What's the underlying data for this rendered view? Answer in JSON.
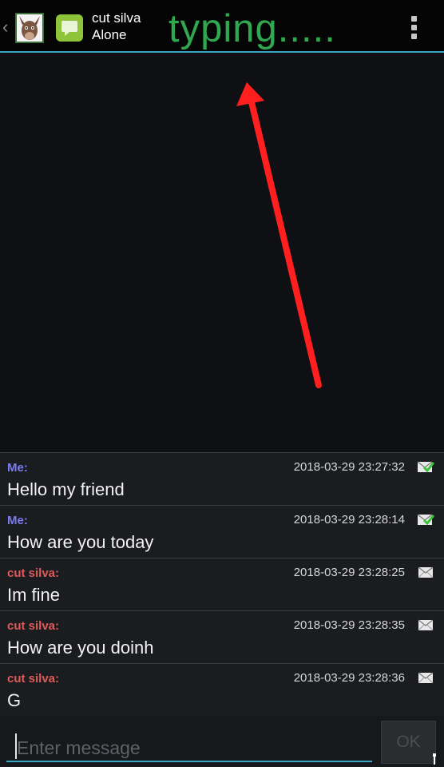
{
  "header": {
    "back_glyph": "‹",
    "title": "cut silva",
    "subtitle": "Alone",
    "annotation": "typing.....",
    "accent_color": "#3aa6c6",
    "annotation_color": "#2fa84f"
  },
  "annotation_arrow": {
    "color": "#ff1f1f",
    "label": ""
  },
  "messages": [
    {
      "sender": "Me:",
      "time": "2018-03-29 23:27:32",
      "text": "Hello my friend",
      "status_icon": "delivered-check-envelope-icon"
    },
    {
      "sender": "Me:",
      "time": "2018-03-29 23:28:14",
      "text": "How are you today",
      "status_icon": "delivered-check-envelope-icon"
    },
    {
      "sender": "cut silva:",
      "time": "2018-03-29 23:28:25",
      "text": "Im fine",
      "status_icon": "envelope-icon"
    },
    {
      "sender": "cut silva:",
      "time": "2018-03-29 23:28:35",
      "text": "How are you doinh",
      "status_icon": "envelope-icon"
    },
    {
      "sender": "cut silva:",
      "time": "2018-03-29 23:28:36",
      "text": "G",
      "status_icon": "envelope-icon"
    }
  ],
  "composer": {
    "placeholder": "Enter message",
    "send_label": "OK"
  },
  "colors": {
    "me_sender": "#7a7cf0",
    "other_sender": "#e05a5a",
    "check_green": "#39c43c"
  }
}
